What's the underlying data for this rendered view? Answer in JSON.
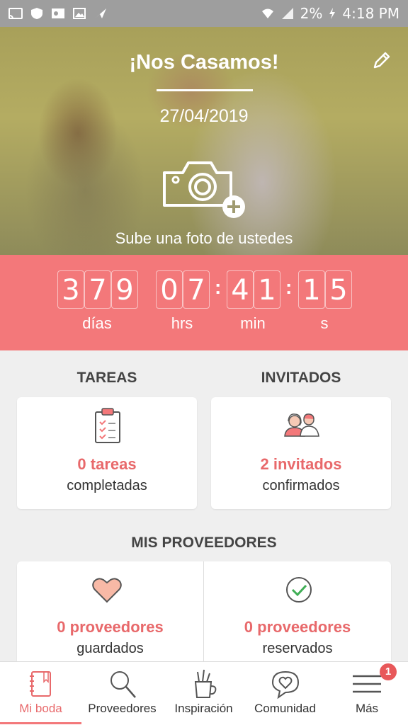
{
  "status_bar": {
    "battery_percent": "2%",
    "time": "4:18 PM"
  },
  "hero": {
    "title": "¡Nos Casamos!",
    "date": "27/04/2019",
    "upload_text": "Sube una foto de ustedes"
  },
  "countdown": {
    "days": [
      "3",
      "7",
      "9"
    ],
    "hours": [
      "0",
      "7"
    ],
    "minutes": [
      "4",
      "1"
    ],
    "seconds": [
      "1",
      "5"
    ],
    "separator": ":",
    "labels": {
      "days": "días",
      "hours": "hrs",
      "minutes": "min",
      "seconds": "s"
    }
  },
  "tasks": {
    "heading": "TAREAS",
    "value": "0 tareas",
    "sub": "completadas"
  },
  "guests": {
    "heading": "INVITADOS",
    "value": "2 invitados",
    "sub": "confirmados"
  },
  "vendors": {
    "heading": "MIS PROVEEDORES",
    "saved": {
      "value": "0 proveedores",
      "sub": "guardados"
    },
    "booked": {
      "value": "0 proveedores",
      "sub": "reservados"
    }
  },
  "bottom_nav": {
    "items": [
      {
        "label": "Mi boda",
        "icon": "notebook-icon",
        "active": true
      },
      {
        "label": "Proveedores",
        "icon": "search-icon"
      },
      {
        "label": "Inspiración",
        "icon": "pencil-cup-icon"
      },
      {
        "label": "Comunidad",
        "icon": "chat-heart-icon"
      },
      {
        "label": "Más",
        "icon": "menu-icon"
      }
    ],
    "more_badge": "1"
  },
  "colors": {
    "accent": "#f3787a",
    "accent_text": "#e8696b"
  }
}
